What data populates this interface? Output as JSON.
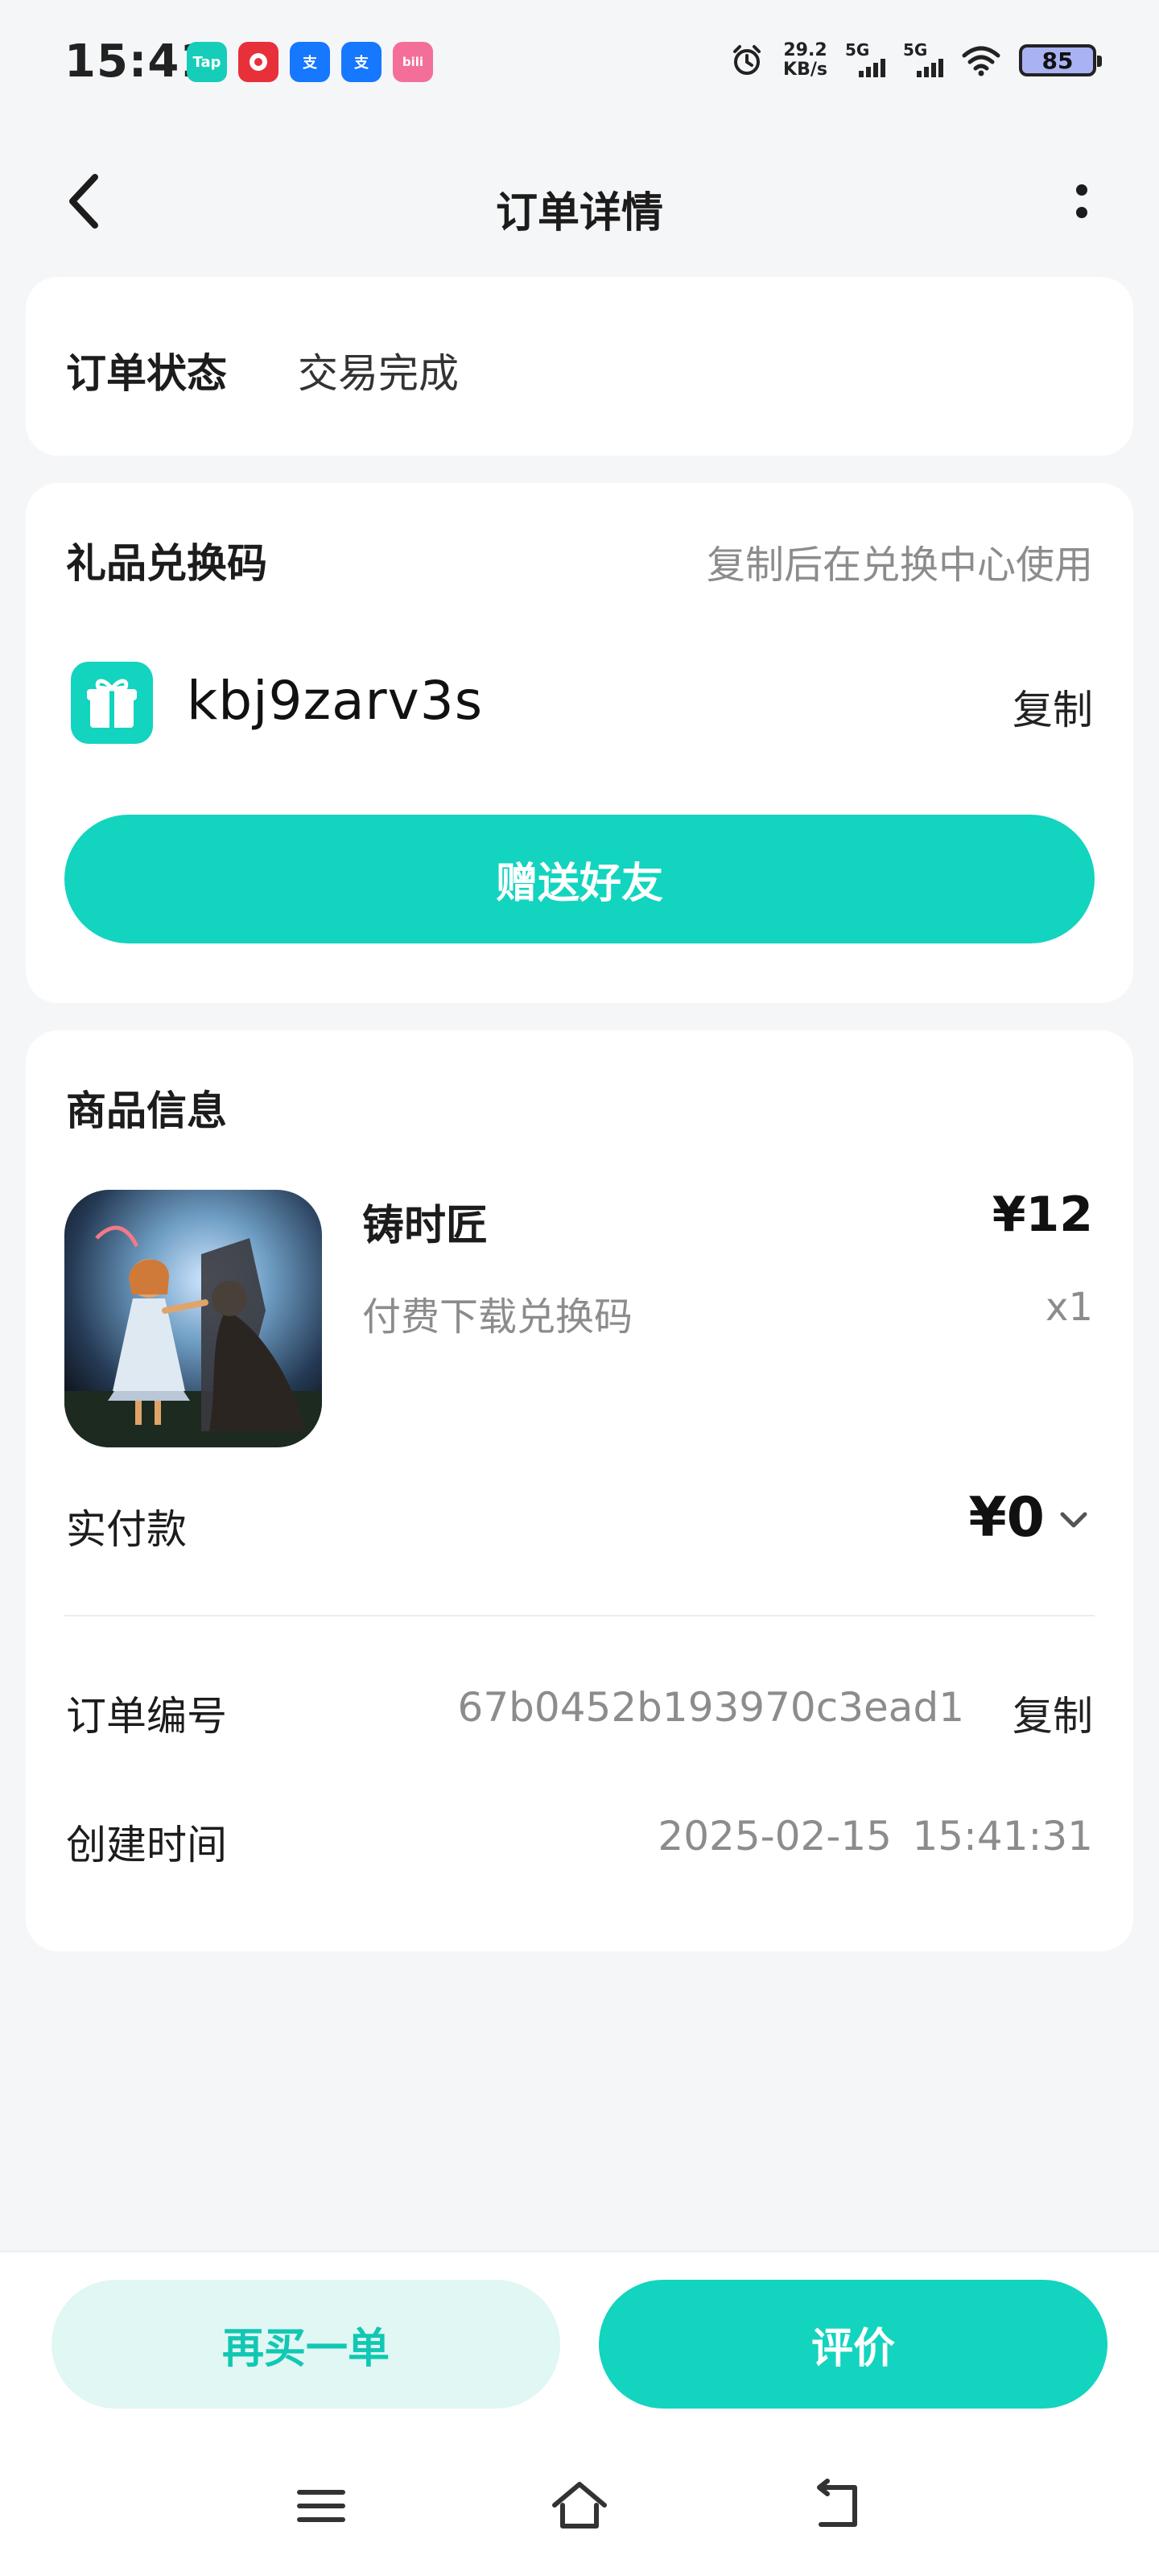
{
  "status_bar": {
    "time": "15:41",
    "app_icons": [
      {
        "label": "Tap",
        "color": "#16cdb9"
      },
      {
        "label": "",
        "color": "#e8303a"
      },
      {
        "label": "支",
        "color": "#1677ff"
      },
      {
        "label": "支",
        "color": "#1677ff"
      },
      {
        "label": "bili",
        "color": "#f36f99"
      }
    ],
    "net_speed": "29.2",
    "net_unit": "KB/s",
    "sim1_label": "5G",
    "sim2_label": "5G",
    "battery": "85"
  },
  "nav": {
    "title": "订单详情"
  },
  "order_status": {
    "label": "订单状态",
    "value": "交易完成"
  },
  "gift_code": {
    "title": "礼品兑换码",
    "hint": "复制后在兑换中心使用",
    "code": "kbj9zarv3s",
    "copy_label": "复制",
    "send_button": "赠送好友"
  },
  "goods": {
    "title": "商品信息",
    "name": "铸时匠",
    "price": "¥12",
    "subtitle": "付费下载兑换码",
    "quantity": "x1",
    "paid_label": "实付款",
    "paid_value": "¥0"
  },
  "order_info": {
    "order_no_label": "订单编号",
    "order_no": "67b0452b193970c3ead1",
    "order_no_copy": "复制",
    "created_label": "创建时间",
    "created_date": "2025-02-15",
    "created_time": "15:41:31"
  },
  "actions": {
    "rebuy": "再买一单",
    "review": "评价"
  },
  "colors": {
    "accent": "#12d4bf",
    "accent_light": "#e0f7f4",
    "background": "#f5f6f8"
  }
}
